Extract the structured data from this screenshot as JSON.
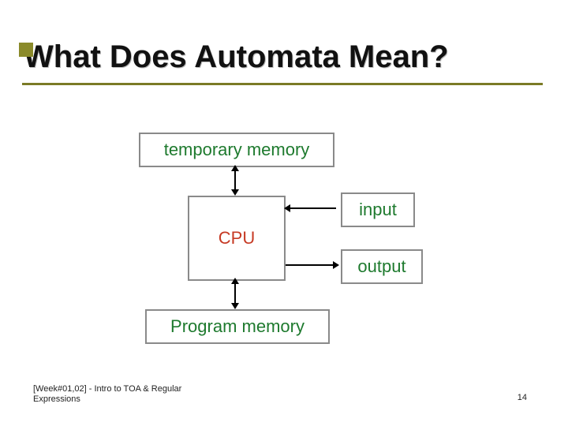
{
  "title": "What Does Automata Mean?",
  "diagram": {
    "temp_memory": "temporary memory",
    "cpu": "CPU",
    "input": "input",
    "output": "output",
    "prog_memory": "Program memory"
  },
  "footer": {
    "left": "[Week#01,02] - Intro to TOA & Regular Expressions",
    "page": "14"
  }
}
